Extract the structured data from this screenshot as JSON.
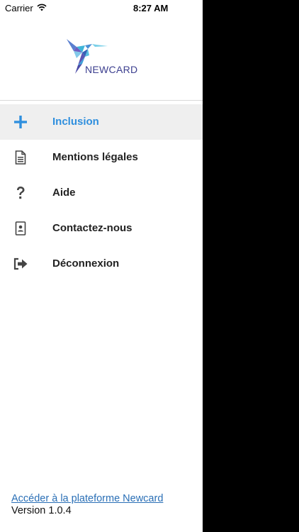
{
  "status_bar": {
    "carrier": "Carrier",
    "time": "8:27 AM",
    "wifi_icon": "wifi-icon"
  },
  "logo": {
    "text": "NEWCARD",
    "icon": "hummingbird-logo"
  },
  "menu": {
    "items": [
      {
        "label": "Inclusion",
        "icon": "plus-icon",
        "active": true
      },
      {
        "label": "Mentions légales",
        "icon": "document-icon",
        "active": false
      },
      {
        "label": "Aide",
        "icon": "question-icon",
        "active": false
      },
      {
        "label": "Contactez-nous",
        "icon": "contact-card-icon",
        "active": false
      },
      {
        "label": "Déconnexion",
        "icon": "sign-out-icon",
        "active": false
      }
    ]
  },
  "footer": {
    "link_label": "Accéder à la plateforme Newcard",
    "version": "Version 1.0.4"
  },
  "colors": {
    "accent": "#2f8fde",
    "active_bg": "#efefef",
    "link": "#2a6fb6",
    "overlay": "#000000"
  }
}
